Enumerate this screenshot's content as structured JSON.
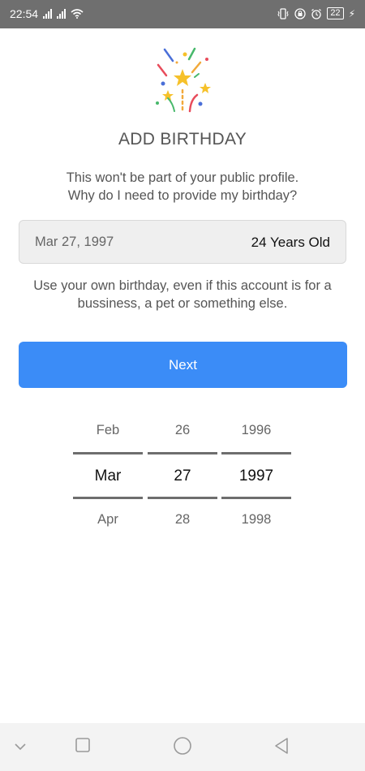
{
  "status": {
    "time": "22:54",
    "battery": "22"
  },
  "screen": {
    "title": "ADD BIRTHDAY",
    "subtitle_line1": "This won't be part of your public profile.",
    "subtitle_line2": "Why do I need to provide my birthday?",
    "date_value": "Mar 27, 1997",
    "age_text": "24 Years Old",
    "info_line1": "Use your own birthday, even if this account is for a",
    "info_line2": "bussiness, a pet or something else.",
    "next_label": "Next"
  },
  "picker": {
    "month": {
      "prev": "Feb",
      "selected": "Mar",
      "next": "Apr"
    },
    "day": {
      "prev": "26",
      "selected": "27",
      "next": "28"
    },
    "year": {
      "prev": "1996",
      "selected": "1997",
      "next": "1998"
    }
  },
  "colors": {
    "accent": "#3b8cf7",
    "status_bar": "#6f6f6f"
  },
  "icons": {
    "confetti": "party-confetti-icon",
    "nav": [
      "chevron-down-icon",
      "square-recents-icon",
      "circle-home-icon",
      "triangle-back-icon"
    ]
  }
}
